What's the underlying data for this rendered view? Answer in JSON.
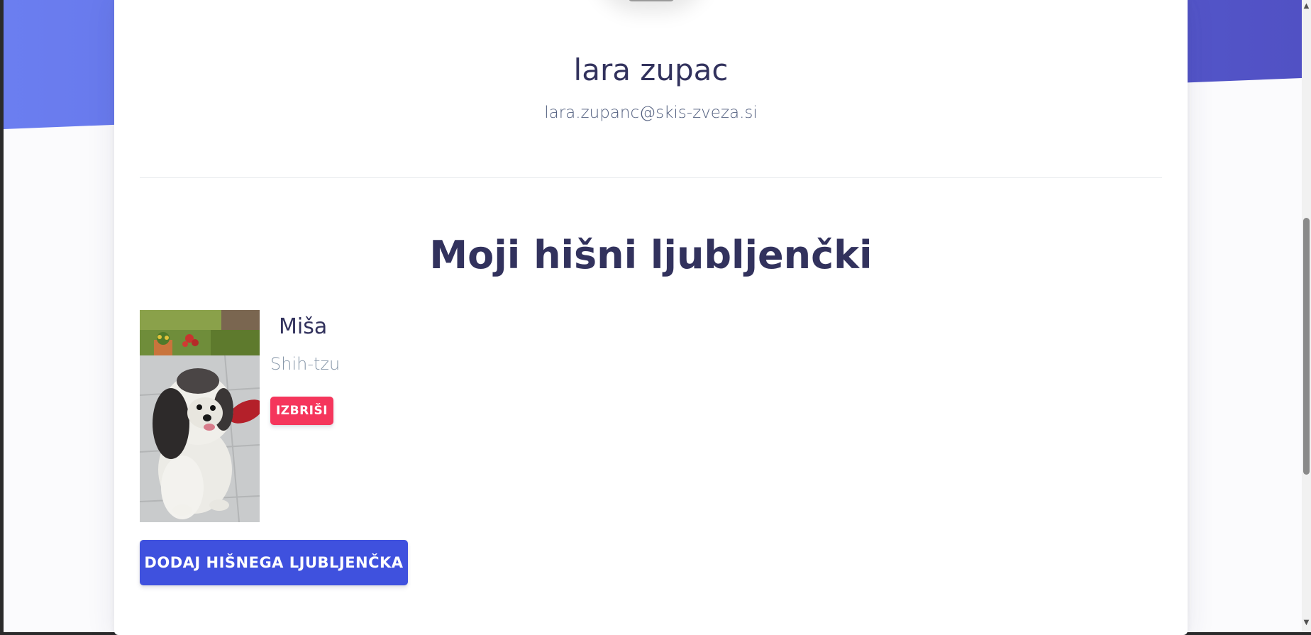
{
  "profile": {
    "name": "lara zupac",
    "email": "lara.zupanc@skis-zveza.si"
  },
  "pets_section": {
    "title": "Moji hišni ljubljenčki",
    "pets": [
      {
        "name": "Miša",
        "breed": "Shih-tzu",
        "delete_label": "IZBRIŠI",
        "photo_icon": "dog-photo"
      }
    ],
    "add_button_label": "DODAJ HIŠNEGA LJUBLJENČKA"
  },
  "colors": {
    "header_gradient_start": "#6b7ef0",
    "header_gradient_end": "#5151c4",
    "primary_button": "#3f51de",
    "danger_button": "#f5365c",
    "heading_text": "#32325d",
    "muted_text": "#8898aa"
  },
  "scrollbar": {
    "up_icon": "scroll-up-arrow-icon",
    "down_icon": "scroll-down-arrow-icon"
  }
}
